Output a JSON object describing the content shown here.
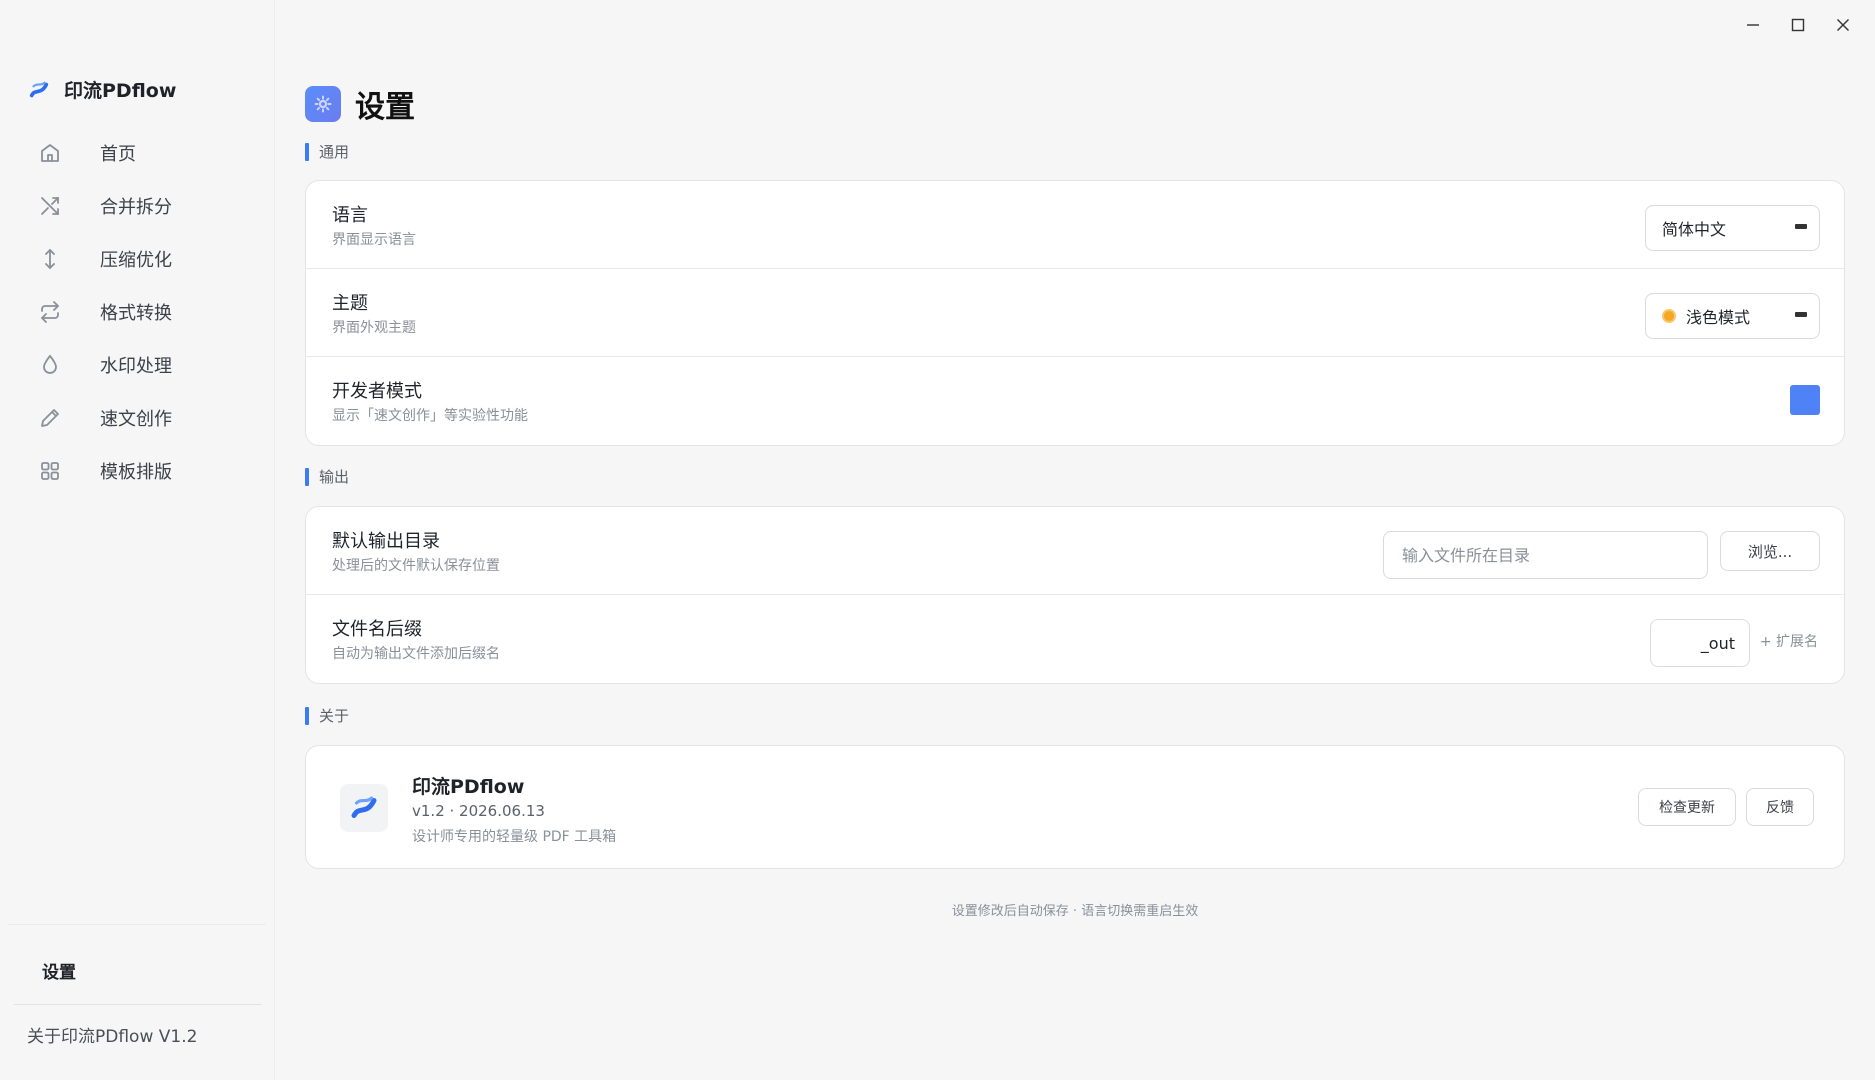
{
  "app": {
    "name": "印流PDflow"
  },
  "window_controls": {
    "minimize": "minimize-icon",
    "maximize": "maximize-icon",
    "close": "close-icon"
  },
  "sidebar": {
    "items": [
      {
        "label": "首页",
        "icon": "home-icon"
      },
      {
        "label": "合并拆分",
        "icon": "shuffle-icon"
      },
      {
        "label": "压缩优化",
        "icon": "vertical-arrows-icon"
      },
      {
        "label": "格式转换",
        "icon": "repeat-icon"
      },
      {
        "label": "水印处理",
        "icon": "droplet-icon"
      },
      {
        "label": "速文创作",
        "icon": "pen-icon"
      },
      {
        "label": "模板排版",
        "icon": "grid-icon"
      }
    ],
    "settings_label": "设置",
    "about_label": "关于印流PDflow  V1.2"
  },
  "page": {
    "title": "设置"
  },
  "sections": {
    "general": "通用",
    "output": "输出",
    "about": "关于"
  },
  "general": {
    "language": {
      "title": "语言",
      "desc": "界面显示语言",
      "value": "简体中文"
    },
    "theme": {
      "title": "主题",
      "desc": "界面外观主题",
      "value": "浅色模式"
    },
    "developer": {
      "title": "开发者模式",
      "desc": "显示「速文创作」等实验性功能",
      "enabled": true
    }
  },
  "output": {
    "directory": {
      "title": "默认输出目录",
      "desc": "处理后的文件默认保存位置",
      "placeholder": "输入文件所在目录",
      "browse_label": "浏览..."
    },
    "suffix": {
      "title": "文件名后缀",
      "desc": "自动为输出文件添加后缀名",
      "value": "_out",
      "ext_note": "+ 扩展名"
    }
  },
  "about": {
    "name": "印流PDflow",
    "version": "v1.2 · 2026.06.13",
    "desc": "设计师专用的轻量级 PDF 工具箱",
    "check_update_label": "检查更新",
    "feedback_label": "反馈"
  },
  "footer": {
    "note": "设置修改后自动保存 · 语言切换需重启生效"
  },
  "colors": {
    "accent": "#4f82f7",
    "section_bar": "#3d7bf5",
    "theme_dot": "#f5a623"
  }
}
